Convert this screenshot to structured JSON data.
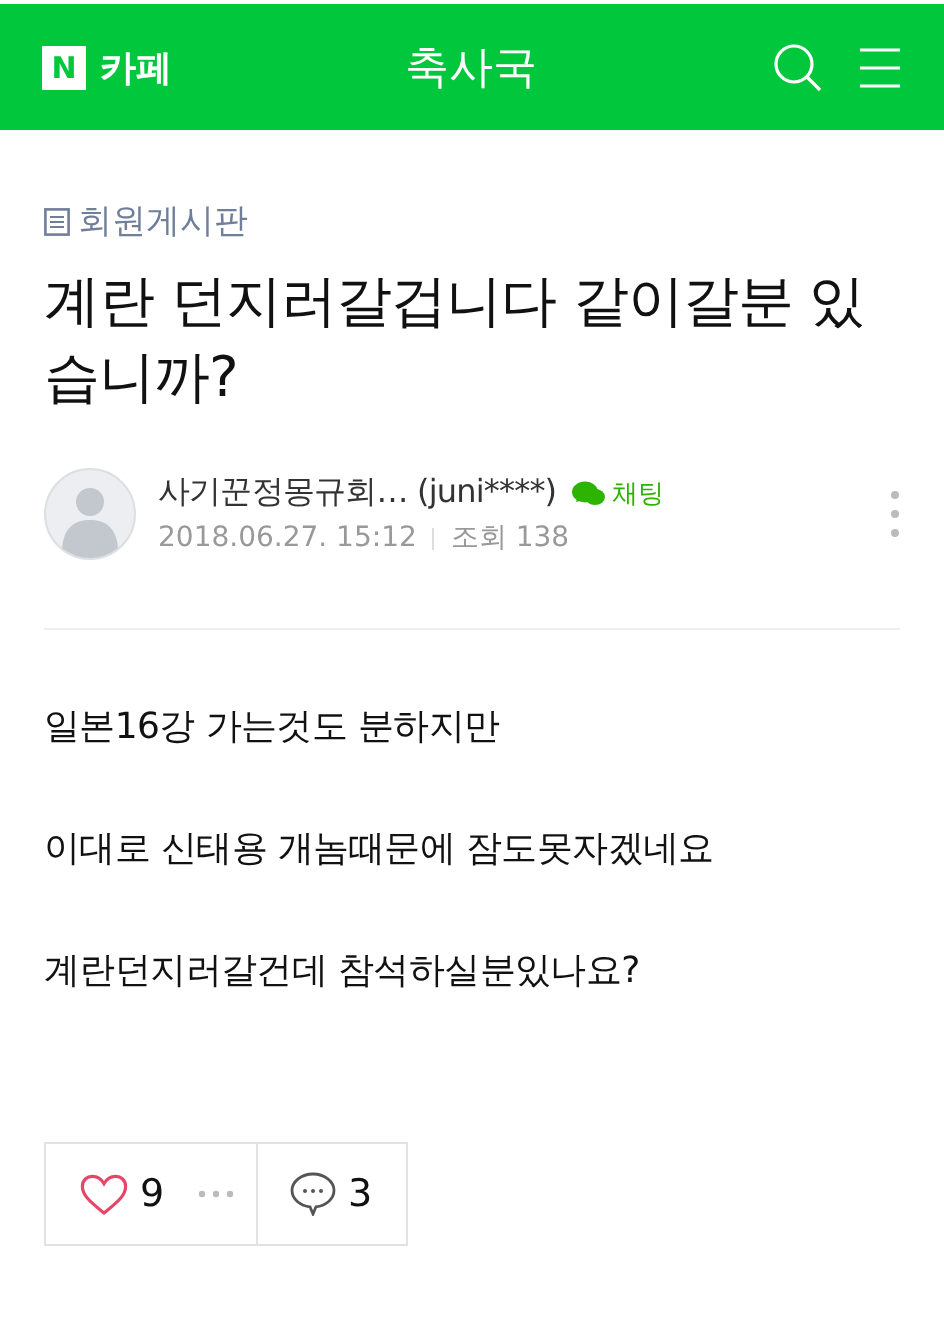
{
  "header": {
    "logo": "N",
    "service": "카페",
    "title": "축사국"
  },
  "post": {
    "board": "회원게시판",
    "title": "계란 던지러갈겁니다 같이갈분 있습니까?",
    "author": {
      "name": "사기꾼정몽규회… (juni****)",
      "chat": "채팅",
      "date": "2018.06.27. 15:12",
      "views": "조회 138"
    },
    "paragraphs": [
      "일본16강 가는것도 분하지만",
      "이대로 신태용 개놈때문에 잠도못자겠네요",
      "계란던지러갈건데 참석하실분있나요?"
    ],
    "likes": {
      "count": "9",
      "liked": false
    },
    "comments": {
      "count": "3"
    }
  }
}
